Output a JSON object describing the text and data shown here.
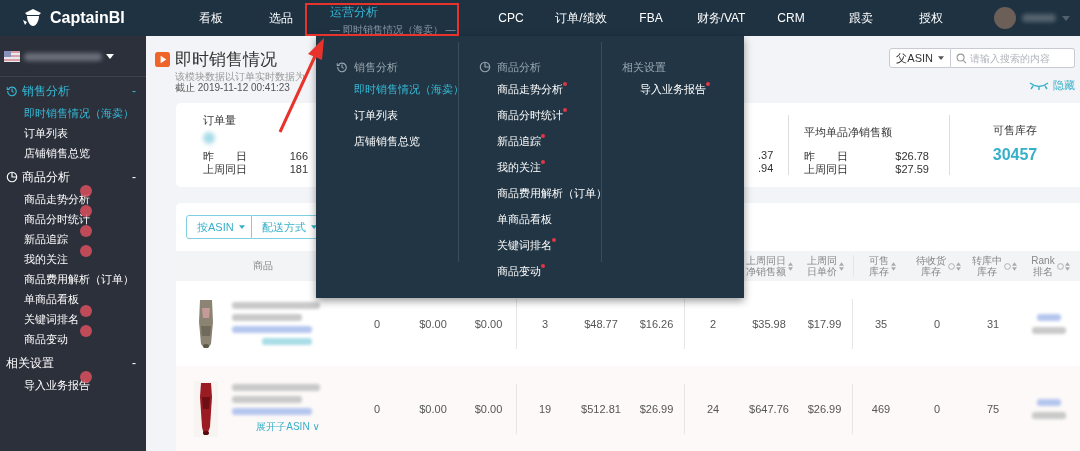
{
  "logo": {
    "text": "CaptainBI"
  },
  "nav": [
    {
      "label": "看板",
      "selected": false
    },
    {
      "label": "选品",
      "selected": false
    },
    {
      "label": "运营分析",
      "sub": "— 即时销售情况（海卖） —",
      "selected": true
    },
    {
      "label": "CPC",
      "selected": false
    },
    {
      "label": "订单/绩效",
      "selected": false
    },
    {
      "label": "FBA",
      "selected": false
    },
    {
      "label": "财务/VAT",
      "selected": false
    },
    {
      "label": "CRM",
      "selected": false
    },
    {
      "label": "跟卖",
      "selected": false
    },
    {
      "label": "授权",
      "selected": false
    }
  ],
  "sidebar": {
    "sections": [
      {
        "label": "销售分析",
        "active": true,
        "toggle": "-",
        "items": [
          {
            "label": "即时销售情况（海卖）",
            "selected": true,
            "dot": false
          },
          {
            "label": "订单列表",
            "selected": false,
            "dot": false
          },
          {
            "label": "店铺销售总览",
            "selected": false,
            "dot": false
          }
        ]
      },
      {
        "label": "商品分析",
        "active": false,
        "toggle": "-",
        "items": [
          {
            "label": "商品走势分析",
            "selected": false,
            "dot": true
          },
          {
            "label": "商品分时统计",
            "selected": false,
            "dot": true
          },
          {
            "label": "新品追踪",
            "selected": false,
            "dot": true
          },
          {
            "label": "我的关注",
            "selected": false,
            "dot": true
          },
          {
            "label": "商品费用解析（订单）",
            "selected": false,
            "dot": false
          },
          {
            "label": "单商品看板",
            "selected": false,
            "dot": false
          },
          {
            "label": "关键词排名",
            "selected": false,
            "dot": true
          },
          {
            "label": "商品变动",
            "selected": false,
            "dot": true
          }
        ]
      },
      {
        "label": "相关设置",
        "active": false,
        "toggle": "-",
        "items": [
          {
            "label": "导入业务报告",
            "selected": false,
            "dot": true
          }
        ]
      }
    ]
  },
  "page": {
    "title": "即时销售情况",
    "note": "该模块数据以订单实时数据为",
    "date": "截止 2019-11-12 00:41:23",
    "asin_select": "父ASIN",
    "search": {
      "placeholder": "请输入搜索的内容"
    },
    "hide_link": "隐藏"
  },
  "stats": {
    "first": {
      "label": "订单量",
      "rows": [
        {
          "label": "昨　　日",
          "value": "166"
        },
        {
          "label": "上周同日",
          "value": "181"
        }
      ]
    },
    "partial": [
      ".37",
      ".94"
    ],
    "avg": {
      "label": "平均单品净销售额",
      "rows": [
        {
          "label": "昨　　日",
          "value": "$26.78"
        },
        {
          "label": "上周同日",
          "value": "$27.59"
        }
      ]
    },
    "stock": {
      "label": "可售库存",
      "value": "30457"
    }
  },
  "filters": [
    "按ASIN",
    "配送方式"
  ],
  "table": {
    "product_column": "商品",
    "columns": [
      {},
      {},
      {},
      {},
      {},
      {},
      {},
      {
        "label": "上周同日净销售额",
        "sort": true,
        "help": false
      },
      {
        "label": "上周同日单价",
        "sort": true,
        "help": false
      },
      {
        "label": "可售库存",
        "sort": true,
        "help": false
      },
      {
        "label": "待收货库存",
        "sort": true,
        "help": true
      },
      {
        "label": "转库中库存",
        "sort": true,
        "help": true
      },
      {
        "label": "Rank排名",
        "sort": true,
        "help": true
      }
    ],
    "rows": [
      {
        "cells": [
          "0",
          "$0.00",
          "$0.00",
          "3",
          "$48.77",
          "$16.26",
          "2",
          "$35.98",
          "$17.99",
          "35",
          "0",
          "31"
        ]
      },
      {
        "cells": [
          "0",
          "$0.00",
          "$0.00",
          "19",
          "$512.81",
          "$26.99",
          "24",
          "$647.76",
          "$26.99",
          "469",
          "0",
          "75"
        ],
        "expand_link": "展开子ASIN ∨"
      }
    ]
  },
  "dropdown": {
    "columns": [
      {
        "title": "销售分析",
        "items": [
          {
            "label": "即时销售情况（海卖）",
            "selected": true,
            "dot": false
          },
          {
            "label": "订单列表",
            "selected": false,
            "dot": false
          },
          {
            "label": "店铺销售总览",
            "selected": false,
            "dot": false
          }
        ]
      },
      {
        "title": "商品分析",
        "items": [
          {
            "label": "商品走势分析",
            "selected": false,
            "dot": true
          },
          {
            "label": "商品分时统计",
            "selected": false,
            "dot": true
          },
          {
            "label": "新品追踪",
            "selected": false,
            "dot": true
          },
          {
            "label": "我的关注",
            "selected": false,
            "dot": true
          },
          {
            "label": "商品费用解析（订单）",
            "selected": false,
            "dot": false
          },
          {
            "label": "单商品看板",
            "selected": false,
            "dot": false
          },
          {
            "label": "关键词排名",
            "selected": false,
            "dot": true
          },
          {
            "label": "商品变动",
            "selected": false,
            "dot": true
          }
        ]
      },
      {
        "title": "相关设置",
        "items": [
          {
            "label": "导入业务报告",
            "selected": false,
            "dot": true
          }
        ]
      }
    ]
  }
}
